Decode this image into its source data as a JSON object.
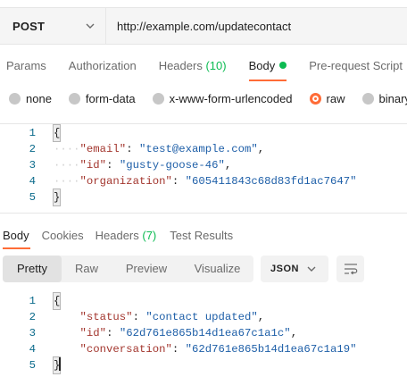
{
  "request": {
    "method": "POST",
    "url": "http://example.com/updatecontact"
  },
  "request_tabs": [
    {
      "label": "Params"
    },
    {
      "label": "Authorization"
    },
    {
      "label": "Headers",
      "count": "(10)"
    },
    {
      "label": "Body",
      "active": true,
      "indicator_color": "#0cbb52"
    },
    {
      "label": "Pre-request Script"
    }
  ],
  "body_types": [
    {
      "label": "none"
    },
    {
      "label": "form-data"
    },
    {
      "label": "x-www-form-urlencoded"
    },
    {
      "label": "raw",
      "selected": true
    },
    {
      "label": "binary"
    }
  ],
  "request_body": {
    "line_numbers": [
      "1",
      "2",
      "3",
      "4",
      "5"
    ],
    "open_brace": "{",
    "close_brace": "}",
    "lines": [
      {
        "key": "\"email\"",
        "value": "\"test@example.com\"",
        "trail": ","
      },
      {
        "key": "\"id\"",
        "value": "\"gusty-goose-46\"",
        "trail": ","
      },
      {
        "key": "\"organization\"",
        "value": "\"605411843c68d83fd1ac7647\"",
        "trail": ""
      }
    ]
  },
  "response_tabs": [
    {
      "label": "Body",
      "active": true
    },
    {
      "label": "Cookies"
    },
    {
      "label": "Headers",
      "count": "(7)"
    },
    {
      "label": "Test Results"
    }
  ],
  "response_view": {
    "modes": [
      "Pretty",
      "Raw",
      "Preview",
      "Visualize"
    ],
    "active_mode": "Pretty",
    "format": "JSON",
    "wrap_icon": "wrap-lines-icon"
  },
  "response_body": {
    "line_numbers": [
      "1",
      "2",
      "3",
      "4",
      "5"
    ],
    "open_brace": "{",
    "close_brace": "}",
    "lines": [
      {
        "key": "\"status\"",
        "value": "\"contact updated\"",
        "trail": ","
      },
      {
        "key": "\"id\"",
        "value": "\"62d761e865b14d1ea67c1a1c\"",
        "trail": ","
      },
      {
        "key": "\"conversation\"",
        "value": "\"62d761e865b14d1ea67c1a19\"",
        "trail": ""
      }
    ]
  },
  "colors": {
    "accent": "#ff6c37",
    "count_green": "#0cbb52",
    "json_key": "#a3362e",
    "json_string": "#1e5fa8",
    "line_number": "#0a6a8b"
  }
}
